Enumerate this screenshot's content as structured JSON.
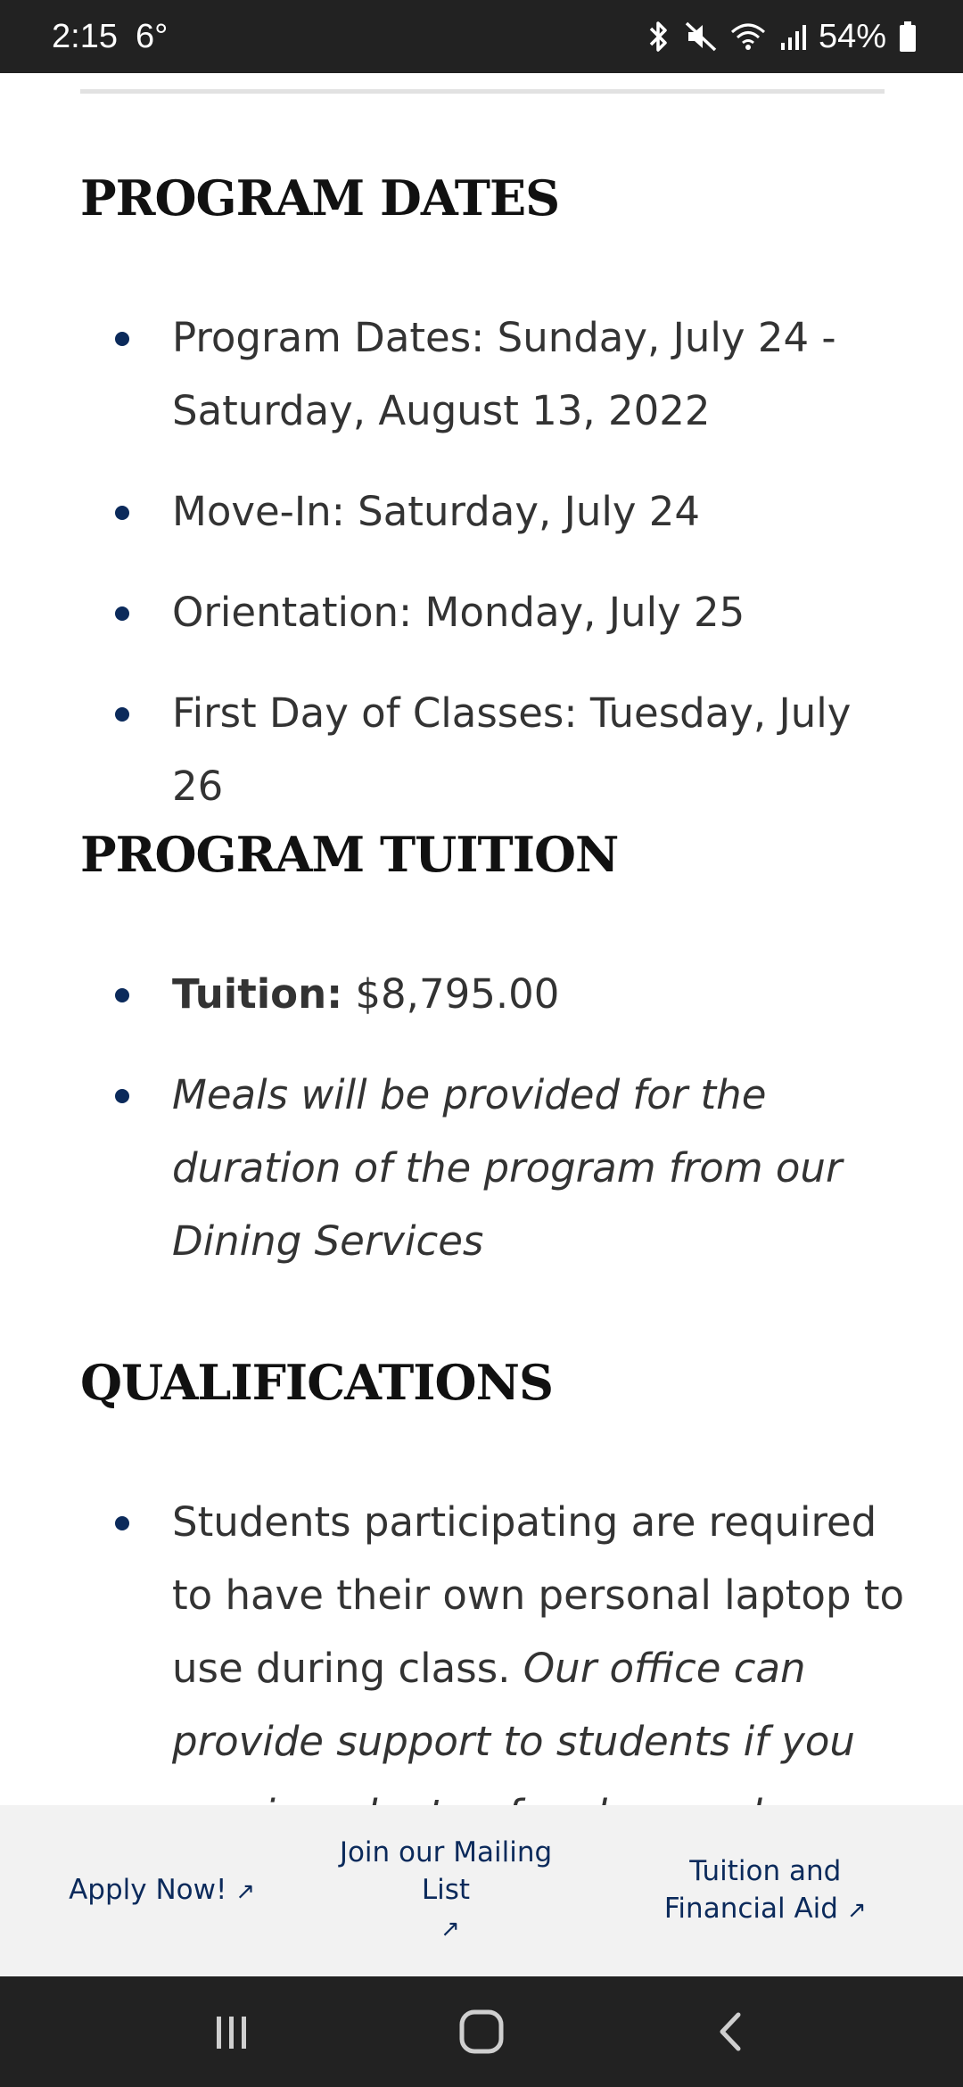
{
  "status_bar": {
    "time": "2:15",
    "temperature": "6°",
    "battery": "54%",
    "icons": [
      "bluetooth-icon",
      "mute-icon",
      "wifi-icon",
      "signal-icon",
      "battery-icon"
    ]
  },
  "sections": {
    "program_dates": {
      "heading": "PROGRAM DATES",
      "items": [
        "Program Dates: Sunday, July 24 - Saturday, August 13, 2022",
        "Move-In:  Saturday, July 24",
        "Orientation: Monday, July 25",
        "First Day of Classes: Tuesday, July 26"
      ]
    },
    "program_tuition": {
      "heading": "PROGRAM TUITION",
      "tuition_label": "Tuition:",
      "tuition_value": " $8,795.00",
      "meals_note": "Meals will be provided for the duration of the program from our Dining Services"
    },
    "qualifications": {
      "heading": "QUALIFICATIONS",
      "item_text": "Students participating are required to have their own personal laptop to use during class. ",
      "item_italic": "Our office can provide support to students if you require a laptop for class and"
    }
  },
  "footer_links": {
    "apply": "Apply Now!",
    "mailing_list": "Join our Mailing List",
    "tuition_aid": "Tuition and Financial Aid",
    "arrow": "↗"
  },
  "colors": {
    "accent": "#0b2a5b",
    "status_bar_bg": "#222222",
    "link_bar_bg": "#f2f2f2"
  }
}
